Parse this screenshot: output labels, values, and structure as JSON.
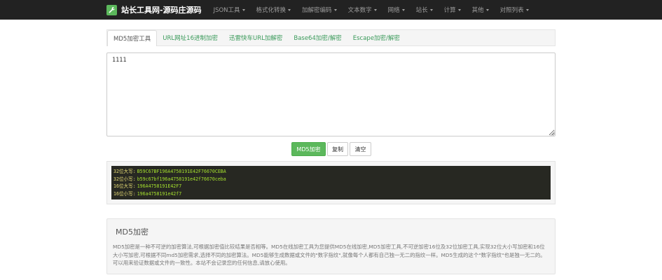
{
  "navbar": {
    "brand": "站长工具网-源码庄源码",
    "items": [
      {
        "label": "JSON工具"
      },
      {
        "label": "格式化转换"
      },
      {
        "label": "加解密编码"
      },
      {
        "label": "文本数字"
      },
      {
        "label": "网络"
      },
      {
        "label": "站长"
      },
      {
        "label": "计算"
      },
      {
        "label": "其他"
      },
      {
        "label": "对照列表"
      }
    ]
  },
  "tabs": [
    {
      "label": "MD5加密工具",
      "active": true
    },
    {
      "label": "URL网址16进制加密",
      "active": false
    },
    {
      "label": "迅雷快车URL加解密",
      "active": false
    },
    {
      "label": "Base64加密/解密",
      "active": false
    },
    {
      "label": "Escape加密/解密",
      "active": false
    }
  ],
  "input": {
    "value": "1111"
  },
  "buttons": {
    "encrypt": "MD5加密",
    "copy": "复制",
    "clear": "清空"
  },
  "results": [
    {
      "label": "32位大写:",
      "value": "B59C67BF196A4758191E42F76670CEBA"
    },
    {
      "label": "32位小写:",
      "value": "b59c67bf196a4758191e42f76670ceba"
    },
    {
      "label": "16位大写:",
      "value": "196A4758191E42F7"
    },
    {
      "label": "16位小写:",
      "value": "196a4758191e42f7"
    }
  ],
  "info": {
    "title": "MD5加密",
    "text": "MD5加密是一种不可逆的加密算法,可根据加密值比较结果是否相等。MD5在线加密工具为您提供MD5在线加密,MD5加密工具,不可逆加密16位及32位加密工具,实现32位大小写加密和16位大小写加密,可根据不同md5加密需求,选择不同的加密算法。MD5能够生成数据或文件的\"数字指纹\",就像每个人都有自己独一无二的指纹一样。MD5生成的这个\"数字指纹\"也是独一无二的。可以用来验证数据或文件的一致性。本站不会记录您的任何信息,请放心使用。"
  },
  "colors": {
    "navbar": "#222222",
    "brand_accent": "#5cb85c",
    "tab_link": "#3a9a5a",
    "result_bg": "#272822",
    "result_label": "#e6db74",
    "result_value": "#a6e22e"
  },
  "icons": {
    "brand": "wrench-icon"
  }
}
